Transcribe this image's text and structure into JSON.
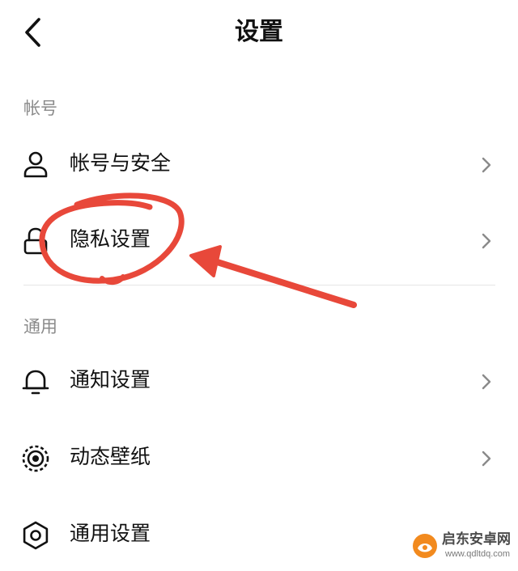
{
  "header": {
    "title": "设置",
    "back_icon": "chevron-left-icon"
  },
  "sections": [
    {
      "label": "帐号",
      "items": [
        {
          "label": "帐号与安全",
          "icon": "user-icon"
        },
        {
          "label": "隐私设置",
          "icon": "lock-icon"
        }
      ]
    },
    {
      "label": "通用",
      "items": [
        {
          "label": "通知设置",
          "icon": "bell-icon"
        },
        {
          "label": "动态壁纸",
          "icon": "live-wallpaper-icon"
        },
        {
          "label": "通用设置",
          "icon": "gear-icon"
        }
      ]
    }
  ],
  "annotation": {
    "color": "#e8483a"
  },
  "watermark": {
    "name": "启东安卓网",
    "url": "www.qdltdq.com",
    "accent": "#f28a1e"
  }
}
